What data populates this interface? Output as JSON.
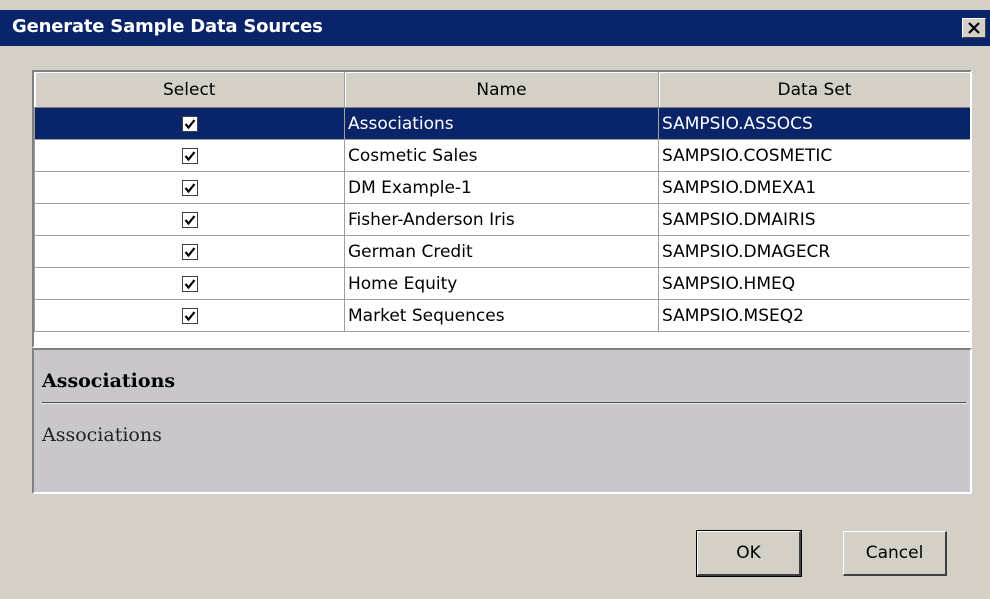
{
  "window": {
    "title": "Generate Sample Data Sources"
  },
  "table": {
    "columns": [
      "Select",
      "Name",
      "Data Set"
    ],
    "rows": [
      {
        "checked": true,
        "name": "Associations",
        "dataset": "SAMPSIO.ASSOCS",
        "selected": true
      },
      {
        "checked": true,
        "name": "Cosmetic Sales",
        "dataset": "SAMPSIO.COSMETIC",
        "selected": false
      },
      {
        "checked": true,
        "name": "DM Example-1",
        "dataset": "SAMPSIO.DMEXA1",
        "selected": false
      },
      {
        "checked": true,
        "name": "Fisher-Anderson Iris",
        "dataset": "SAMPSIO.DMAIRIS",
        "selected": false
      },
      {
        "checked": true,
        "name": "German Credit",
        "dataset": "SAMPSIO.DMAGECR",
        "selected": false
      },
      {
        "checked": true,
        "name": "Home Equity",
        "dataset": "SAMPSIO.HMEQ",
        "selected": false
      },
      {
        "checked": true,
        "name": "Market Sequences",
        "dataset": "SAMPSIO.MSEQ2",
        "selected": false
      }
    ]
  },
  "description": {
    "title": "Associations",
    "body": "Associations"
  },
  "buttons": {
    "ok": "OK",
    "cancel": "Cancel"
  },
  "icons": {
    "close": "close-icon",
    "check": "checkmark-icon"
  },
  "colors": {
    "titlebar": "#0a246a",
    "selection": "#0a246a",
    "face": "#d4d0c8",
    "description_bg": "#c9c6cc"
  }
}
